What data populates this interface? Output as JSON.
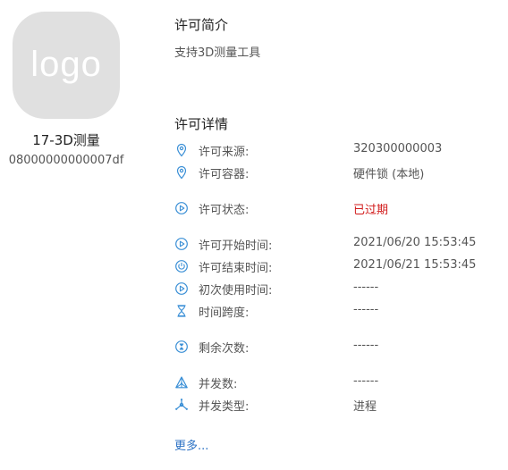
{
  "product": {
    "logo_text": "logo",
    "name": "17-3D测量",
    "id": "08000000000007df"
  },
  "intro": {
    "title": "许可简介",
    "text": "支持3D测量工具"
  },
  "details": {
    "title": "许可详情",
    "rows": [
      {
        "icon": "location-pin-icon",
        "label": "许可来源:",
        "value": "320300000003"
      },
      {
        "icon": "location-pin-icon",
        "label": "许可容器:",
        "value": "硬件锁 (本地)"
      },
      {
        "icon": "play-circle-icon",
        "label": "许可状态:",
        "value": "已过期"
      },
      {
        "icon": "play-circle-icon",
        "label": "许可开始时间:",
        "value": "2021/06/20 15:53:45"
      },
      {
        "icon": "power-circle-icon",
        "label": "许可结束时间:",
        "value": "2021/06/21 15:53:45"
      },
      {
        "icon": "play-circle-icon",
        "label": "初次使用时间:",
        "value": "------"
      },
      {
        "icon": "hourglass-icon",
        "label": "时间跨度:",
        "value": "------"
      },
      {
        "icon": "hourglass-circle-icon",
        "label": "剩余次数:",
        "value": "------"
      },
      {
        "icon": "network-triangle-icon",
        "label": "并发数:",
        "value": "------"
      },
      {
        "icon": "network-star-icon",
        "label": "并发类型:",
        "value": "进程"
      }
    ]
  },
  "more_link": "更多...",
  "colors": {
    "icon": "#3a8fd6",
    "expired": "#d11a1a",
    "link": "#2c72c4",
    "logo_bg": "#e0e0e0"
  }
}
